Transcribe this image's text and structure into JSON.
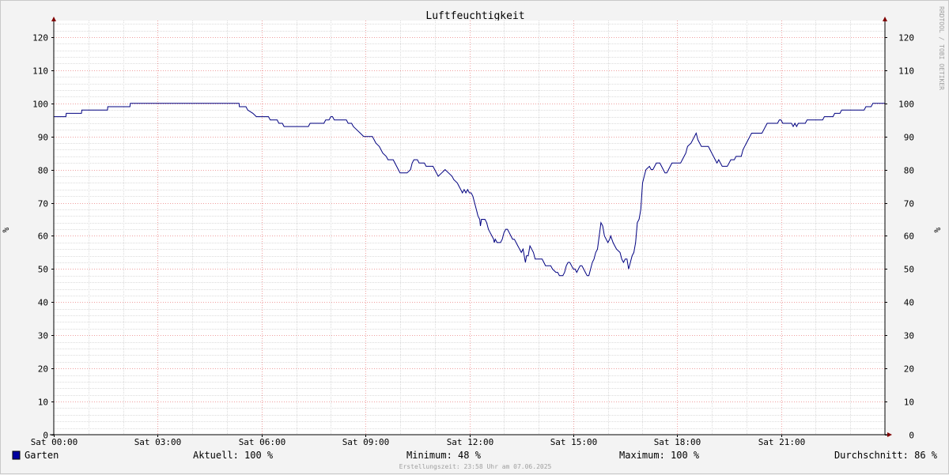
{
  "chart_data": {
    "type": "line",
    "title": "Luftfeuchtigkeit",
    "ylabel_left": "%",
    "ylabel_right": "%",
    "ylim": [
      0,
      125
    ],
    "yticks": [
      0,
      10,
      20,
      30,
      40,
      50,
      60,
      70,
      80,
      90,
      100,
      110,
      120
    ],
    "xlim_hours": [
      0,
      24
    ],
    "xticks": [
      {
        "h": 0,
        "label": "Sat 00:00"
      },
      {
        "h": 3,
        "label": "Sat 03:00"
      },
      {
        "h": 6,
        "label": "Sat 06:00"
      },
      {
        "h": 9,
        "label": "Sat 09:00"
      },
      {
        "h": 12,
        "label": "Sat 12:00"
      },
      {
        "h": 15,
        "label": "Sat 15:00"
      },
      {
        "h": 18,
        "label": "Sat 18:00"
      },
      {
        "h": 21,
        "label": "Sat 21:00"
      }
    ],
    "grid": true,
    "series": [
      {
        "name": "Garten",
        "color": "#000080",
        "points": [
          [
            0.0,
            96
          ],
          [
            0.35,
            96
          ],
          [
            0.36,
            97
          ],
          [
            0.8,
            97
          ],
          [
            0.81,
            98
          ],
          [
            1.55,
            98
          ],
          [
            1.56,
            99
          ],
          [
            2.2,
            99
          ],
          [
            2.21,
            100
          ],
          [
            5.35,
            100
          ],
          [
            5.36,
            99
          ],
          [
            5.55,
            99
          ],
          [
            5.6,
            98
          ],
          [
            5.75,
            97
          ],
          [
            5.85,
            96
          ],
          [
            6.2,
            96
          ],
          [
            6.25,
            95
          ],
          [
            6.45,
            95
          ],
          [
            6.5,
            94
          ],
          [
            6.6,
            94
          ],
          [
            6.65,
            93
          ],
          [
            7.35,
            93
          ],
          [
            7.4,
            94
          ],
          [
            7.8,
            94
          ],
          [
            7.85,
            95
          ],
          [
            7.95,
            95
          ],
          [
            8.0,
            96
          ],
          [
            8.05,
            96
          ],
          [
            8.1,
            95
          ],
          [
            8.45,
            95
          ],
          [
            8.5,
            94
          ],
          [
            8.6,
            94
          ],
          [
            8.65,
            93
          ],
          [
            8.75,
            92
          ],
          [
            8.85,
            91
          ],
          [
            8.95,
            90
          ],
          [
            9.2,
            90
          ],
          [
            9.25,
            89
          ],
          [
            9.3,
            88
          ],
          [
            9.4,
            87
          ],
          [
            9.5,
            85
          ],
          [
            9.6,
            84
          ],
          [
            9.65,
            83
          ],
          [
            9.8,
            83
          ],
          [
            9.9,
            81
          ],
          [
            9.95,
            80
          ],
          [
            10.0,
            79
          ],
          [
            10.2,
            79
          ],
          [
            10.3,
            80
          ],
          [
            10.35,
            82
          ],
          [
            10.4,
            83
          ],
          [
            10.5,
            83
          ],
          [
            10.55,
            82
          ],
          [
            10.7,
            82
          ],
          [
            10.75,
            81
          ],
          [
            10.95,
            81
          ],
          [
            11.0,
            80
          ],
          [
            11.05,
            79
          ],
          [
            11.1,
            78
          ],
          [
            11.2,
            79
          ],
          [
            11.3,
            80
          ],
          [
            11.4,
            79
          ],
          [
            11.5,
            78
          ],
          [
            11.55,
            77
          ],
          [
            11.65,
            76
          ],
          [
            11.7,
            75
          ],
          [
            11.75,
            74
          ],
          [
            11.8,
            73
          ],
          [
            11.85,
            74
          ],
          [
            11.9,
            73
          ],
          [
            11.95,
            74
          ],
          [
            12.0,
            73
          ],
          [
            12.05,
            73
          ],
          [
            12.1,
            72
          ],
          [
            12.15,
            70
          ],
          [
            12.2,
            68
          ],
          [
            12.25,
            66
          ],
          [
            12.3,
            65
          ],
          [
            12.32,
            63
          ],
          [
            12.35,
            65
          ],
          [
            12.45,
            65
          ],
          [
            12.5,
            64
          ],
          [
            12.55,
            62
          ],
          [
            12.6,
            61
          ],
          [
            12.65,
            60
          ],
          [
            12.7,
            59
          ],
          [
            12.72,
            58
          ],
          [
            12.75,
            59
          ],
          [
            12.8,
            58
          ],
          [
            12.9,
            58
          ],
          [
            12.95,
            59
          ],
          [
            13.0,
            61
          ],
          [
            13.05,
            62
          ],
          [
            13.1,
            62
          ],
          [
            13.15,
            61
          ],
          [
            13.2,
            60
          ],
          [
            13.25,
            59
          ],
          [
            13.3,
            59
          ],
          [
            13.35,
            58
          ],
          [
            13.4,
            57
          ],
          [
            13.45,
            56
          ],
          [
            13.5,
            55
          ],
          [
            13.55,
            56
          ],
          [
            13.6,
            53
          ],
          [
            13.62,
            52
          ],
          [
            13.65,
            54
          ],
          [
            13.7,
            54
          ],
          [
            13.75,
            57
          ],
          [
            13.8,
            56
          ],
          [
            13.85,
            55
          ],
          [
            13.9,
            53
          ],
          [
            14.0,
            53
          ],
          [
            14.1,
            53
          ],
          [
            14.15,
            52
          ],
          [
            14.2,
            51
          ],
          [
            14.35,
            51
          ],
          [
            14.4,
            50
          ],
          [
            14.5,
            49
          ],
          [
            14.55,
            49
          ],
          [
            14.6,
            48
          ],
          [
            14.7,
            48
          ],
          [
            14.75,
            49
          ],
          [
            14.8,
            51
          ],
          [
            14.85,
            52
          ],
          [
            14.9,
            52
          ],
          [
            14.95,
            51
          ],
          [
            15.0,
            50
          ],
          [
            15.05,
            50
          ],
          [
            15.1,
            49
          ],
          [
            15.15,
            50
          ],
          [
            15.2,
            51
          ],
          [
            15.25,
            51
          ],
          [
            15.3,
            50
          ],
          [
            15.35,
            49
          ],
          [
            15.4,
            48
          ],
          [
            15.45,
            48
          ],
          [
            15.5,
            50
          ],
          [
            15.55,
            52
          ],
          [
            15.6,
            53
          ],
          [
            15.65,
            55
          ],
          [
            15.7,
            56
          ],
          [
            15.75,
            60
          ],
          [
            15.8,
            64
          ],
          [
            15.85,
            63
          ],
          [
            15.9,
            60
          ],
          [
            15.95,
            59
          ],
          [
            16.0,
            58
          ],
          [
            16.05,
            59
          ],
          [
            16.08,
            60
          ],
          [
            16.15,
            58
          ],
          [
            16.2,
            57
          ],
          [
            16.25,
            56
          ],
          [
            16.35,
            55
          ],
          [
            16.4,
            53
          ],
          [
            16.45,
            52
          ],
          [
            16.5,
            53
          ],
          [
            16.55,
            53
          ],
          [
            16.6,
            50
          ],
          [
            16.65,
            52
          ],
          [
            16.7,
            54
          ],
          [
            16.75,
            55
          ],
          [
            16.8,
            58
          ],
          [
            16.85,
            64
          ],
          [
            16.9,
            65
          ],
          [
            16.95,
            68
          ],
          [
            17.0,
            76
          ],
          [
            17.05,
            78
          ],
          [
            17.1,
            80
          ],
          [
            17.2,
            81
          ],
          [
            17.25,
            80
          ],
          [
            17.3,
            80
          ],
          [
            17.35,
            81
          ],
          [
            17.4,
            82
          ],
          [
            17.5,
            82
          ],
          [
            17.55,
            81
          ],
          [
            17.6,
            80
          ],
          [
            17.65,
            79
          ],
          [
            17.7,
            79
          ],
          [
            17.75,
            80
          ],
          [
            17.8,
            81
          ],
          [
            17.85,
            82
          ],
          [
            18.1,
            82
          ],
          [
            18.15,
            83
          ],
          [
            18.2,
            84
          ],
          [
            18.25,
            85
          ],
          [
            18.3,
            87
          ],
          [
            18.4,
            88
          ],
          [
            18.45,
            89
          ],
          [
            18.5,
            90
          ],
          [
            18.55,
            91
          ],
          [
            18.6,
            89
          ],
          [
            18.65,
            88
          ],
          [
            18.7,
            87
          ],
          [
            18.9,
            87
          ],
          [
            18.95,
            86
          ],
          [
            19.0,
            85
          ],
          [
            19.05,
            84
          ],
          [
            19.1,
            83
          ],
          [
            19.15,
            82
          ],
          [
            19.2,
            83
          ],
          [
            19.25,
            82
          ],
          [
            19.3,
            81
          ],
          [
            19.45,
            81
          ],
          [
            19.5,
            82
          ],
          [
            19.55,
            83
          ],
          [
            19.65,
            83
          ],
          [
            19.7,
            84
          ],
          [
            19.85,
            84
          ],
          [
            19.9,
            86
          ],
          [
            19.95,
            87
          ],
          [
            20.0,
            88
          ],
          [
            20.05,
            89
          ],
          [
            20.1,
            90
          ],
          [
            20.15,
            91
          ],
          [
            20.45,
            91
          ],
          [
            20.5,
            92
          ],
          [
            20.55,
            93
          ],
          [
            20.6,
            94
          ],
          [
            20.9,
            94
          ],
          [
            20.95,
            95
          ],
          [
            21.0,
            95
          ],
          [
            21.05,
            94
          ],
          [
            21.3,
            94
          ],
          [
            21.35,
            93
          ],
          [
            21.4,
            94
          ],
          [
            21.45,
            93
          ],
          [
            21.5,
            94
          ],
          [
            21.7,
            94
          ],
          [
            21.75,
            95
          ],
          [
            22.2,
            95
          ],
          [
            22.25,
            96
          ],
          [
            22.5,
            96
          ],
          [
            22.55,
            97
          ],
          [
            22.7,
            97
          ],
          [
            22.75,
            98
          ],
          [
            23.05,
            98
          ],
          [
            23.1,
            98
          ],
          [
            23.4,
            98
          ],
          [
            23.45,
            99
          ],
          [
            23.6,
            99
          ],
          [
            23.65,
            100
          ],
          [
            24.0,
            100
          ]
        ]
      }
    ]
  },
  "legend": {
    "series_name": "Garten",
    "swatch_color": "#0000a0",
    "current": "Aktuell: 100 %",
    "minimum": "Minimum:  48 %",
    "maximum": "Maximum: 100 %",
    "average": "Durchschnitt:  86 %"
  },
  "footer": {
    "created": "Erstellungszeit: 23:58 Uhr am 07.06.2025"
  },
  "watermark": "RRDTOOL / TOBI OETIKER",
  "colors": {
    "canvas": "#ffffff",
    "background": "#f3f3f3",
    "major_grid": "#f0a0a0",
    "minor_grid": "#dcdcdc",
    "axis": "#000000",
    "arrow": "#800000",
    "line": "#000080"
  }
}
